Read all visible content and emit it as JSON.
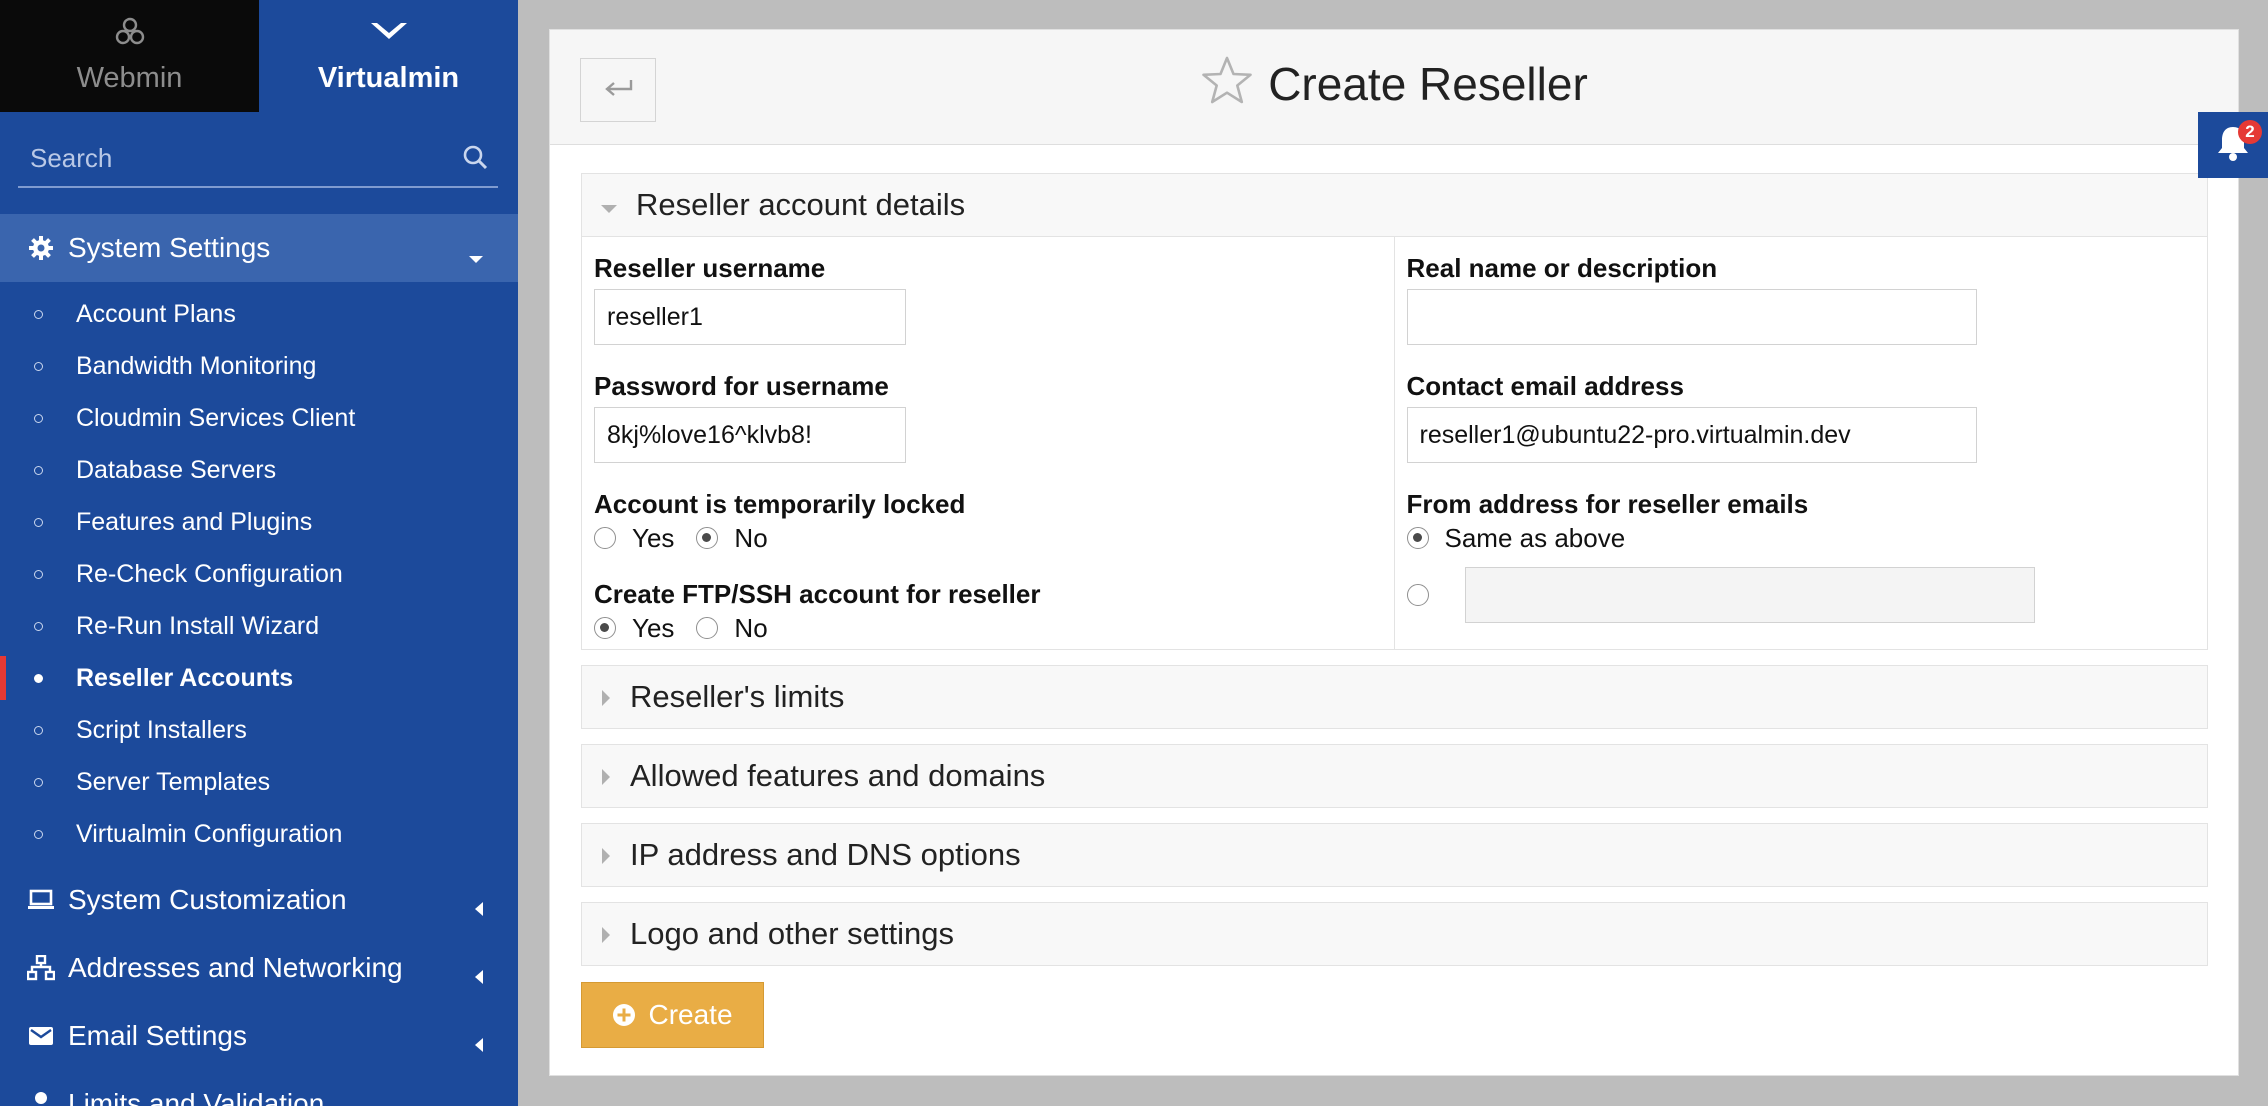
{
  "switcher": {
    "webmin": "Webmin",
    "virtualmin": "Virtualmin"
  },
  "search": {
    "placeholder": "Search"
  },
  "sidebar": {
    "open_category": {
      "label": "System Settings",
      "icon": "gear-icon"
    },
    "items": [
      "Account Plans",
      "Bandwidth Monitoring",
      "Cloudmin Services Client",
      "Database Servers",
      "Features and Plugins",
      "Re-Check Configuration",
      "Re-Run Install Wizard",
      "Reseller Accounts",
      "Script Installers",
      "Server Templates",
      "Virtualmin Configuration"
    ],
    "active_item": "Reseller Accounts",
    "categories": [
      {
        "label": "System Customization",
        "icon": "laptop-icon"
      },
      {
        "label": "Addresses and Networking",
        "icon": "network-icon"
      },
      {
        "label": "Email Settings",
        "icon": "envelope-icon"
      },
      {
        "label": "Limits and Validation",
        "icon": "user-icon"
      }
    ]
  },
  "page": {
    "title": "Create Reseller",
    "back_icon": "back-arrow-icon"
  },
  "details": {
    "heading": "Reseller account details",
    "username_label": "Reseller username",
    "username_value": "reseller1",
    "password_label": "Password for username",
    "password_value": "8kj%love16^klvb8!",
    "locked_label": "Account is temporarily locked",
    "locked_yes": "Yes",
    "locked_no": "No",
    "locked_selected": "No",
    "ftp_label": "Create FTP/SSH account for reseller",
    "ftp_yes": "Yes",
    "ftp_no": "No",
    "ftp_selected": "Yes",
    "realname_label": "Real name or description",
    "realname_value": "",
    "email_label": "Contact email address",
    "email_value": "reseller1@ubuntu22-pro.virtualmin.dev",
    "from_label": "From address for reseller emails",
    "from_same": "Same as above",
    "from_selected": "Same as above",
    "from_custom_value": ""
  },
  "sections": [
    "Reseller's limits",
    "Allowed features and domains",
    "IP address and DNS options",
    "Logo and other settings"
  ],
  "create_button": "Create",
  "notifications": {
    "count": "2"
  },
  "colors": {
    "sidebar": "#1c4a9b",
    "active_marker": "#e53935",
    "create_button": "#e9ad45"
  }
}
